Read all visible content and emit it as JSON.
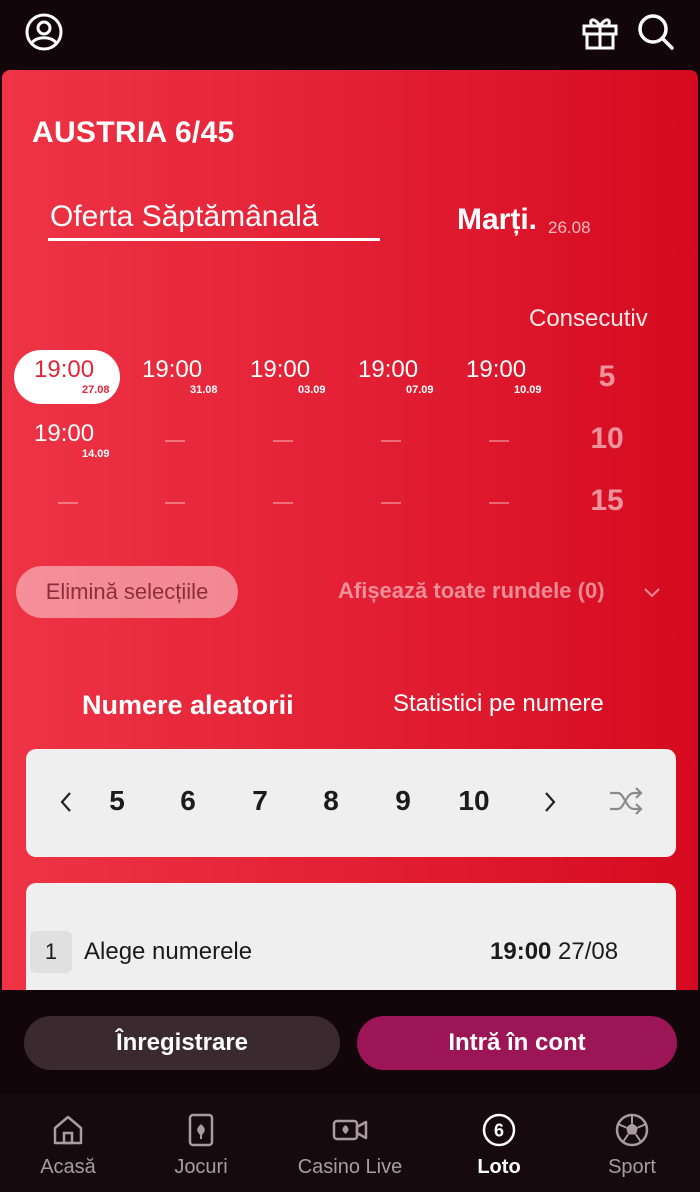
{
  "header": {
    "profile_icon": "user-circle-icon",
    "gift_icon": "gift-icon",
    "search_icon": "search-icon"
  },
  "game": {
    "title": "AUSTRIA 6/45",
    "tabs": {
      "weekly": "Oferta Săptămânală",
      "day_label": "Marți.",
      "day_date": "26.08"
    }
  },
  "draws": {
    "consecutive_label": "Consecutiv",
    "row1": [
      {
        "time": "19:00",
        "date": "27.08",
        "selected": true
      },
      {
        "time": "19:00",
        "date": "31.08"
      },
      {
        "time": "19:00",
        "date": "03.09"
      },
      {
        "time": "19:00",
        "date": "07.09"
      },
      {
        "time": "19:00",
        "date": "10.09"
      }
    ],
    "row2_first": {
      "time": "19:00",
      "date": "14.09"
    },
    "consecutive_options": [
      "5",
      "10",
      "15"
    ],
    "clear_label": "Elimină selecțiile",
    "show_all_label": "Afișează toate rundele (0)"
  },
  "number_tabs": {
    "random": "Numere aleatorii",
    "stats": "Statistici pe numere"
  },
  "number_picker": {
    "options": [
      "5",
      "6",
      "7",
      "8",
      "9",
      "10"
    ],
    "shuffle_icon": "shuffle-icon"
  },
  "bet": {
    "index": "1",
    "label": "Alege numerele",
    "time": "19:00",
    "date": "27/08"
  },
  "actions": {
    "register": "Înregistrare",
    "login": "Intră în cont"
  },
  "bottom_nav": [
    {
      "label": "Acasă",
      "icon": "home-icon"
    },
    {
      "label": "Jocuri",
      "icon": "cards-icon"
    },
    {
      "label": "Casino Live",
      "icon": "video-camera-icon"
    },
    {
      "label": "Loto",
      "icon": "lotto-ball-icon",
      "active": true
    },
    {
      "label": "Sport",
      "icon": "soccer-ball-icon"
    }
  ],
  "colors": {
    "card_red": "#e21e33",
    "login_purple": "#9c1556",
    "register_dark": "#3a2a30",
    "nav_bg": "#160a0f"
  }
}
